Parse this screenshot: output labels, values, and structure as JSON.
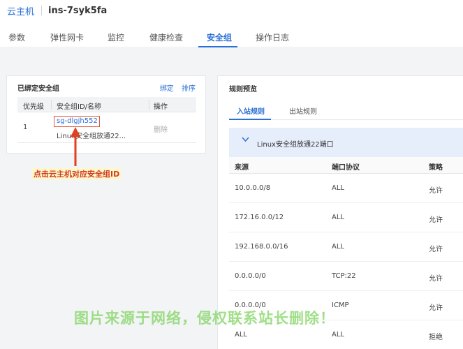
{
  "breadcrumb": {
    "root": "云主机",
    "instance": "ins-7syk5fa"
  },
  "tabs": [
    {
      "label": "参数"
    },
    {
      "label": "弹性网卡"
    },
    {
      "label": "监控"
    },
    {
      "label": "健康检查"
    },
    {
      "label": "安全组"
    },
    {
      "label": "操作日志"
    }
  ],
  "bound_panel": {
    "title": "已绑定安全组",
    "bind_label": "绑定",
    "sort_label": "排序",
    "columns": [
      "优先级",
      "安全组ID/名称",
      "操作"
    ],
    "rows": [
      {
        "priority": "1",
        "sg_id": "sg-dlgjh552",
        "sg_name": "Linux安全组放通22...",
        "action": "删除"
      }
    ]
  },
  "annotation": "点击云主机对应安全组ID",
  "rules_panel": {
    "title": "规则预览",
    "tab_inbound": "入站规则",
    "tab_outbound": "出站规则",
    "group_name": "Linux安全组放通22端口",
    "columns": [
      "来源",
      "端口协议",
      "策略"
    ],
    "rows": [
      {
        "source": "10.0.0.0/8",
        "port": "ALL",
        "policy": "允许"
      },
      {
        "source": "172.16.0.0/12",
        "port": "ALL",
        "policy": "允许"
      },
      {
        "source": "192.168.0.0/16",
        "port": "ALL",
        "policy": "允许"
      },
      {
        "source": "0.0.0.0/0",
        "port": "TCP:22",
        "policy": "允许"
      },
      {
        "source": "0.0.0.0/0",
        "port": "ICMP",
        "policy": "允许"
      },
      {
        "source": "ALL",
        "port": "ALL",
        "policy": "拒绝"
      }
    ]
  },
  "watermark": "图片来源于网络，侵权联系站长删除！",
  "colors": {
    "accent": "#2b6fd6",
    "highlight": "#e05a3f",
    "group_bg": "#e6eefb",
    "watermark": "#80d460"
  }
}
